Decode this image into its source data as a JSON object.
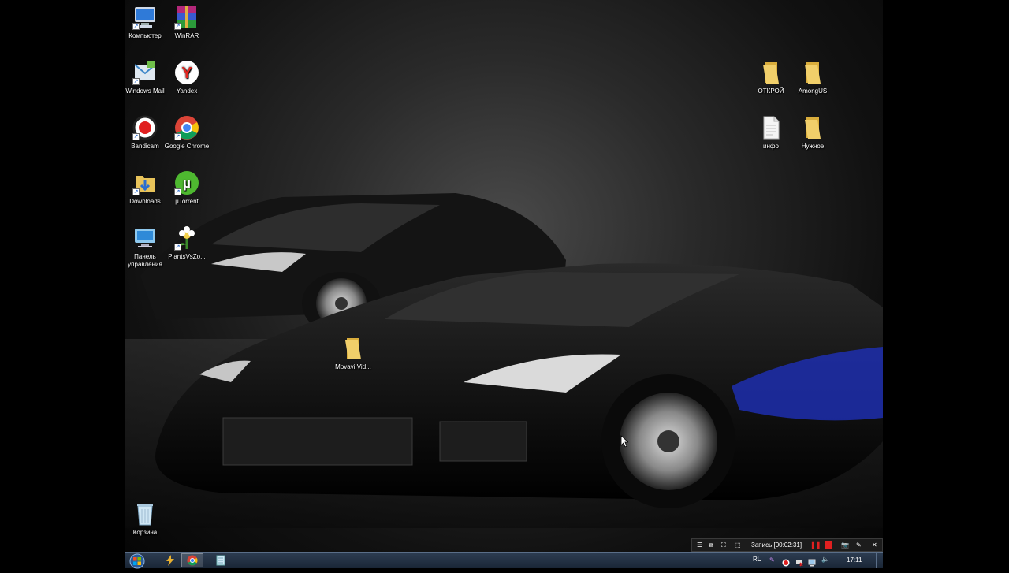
{
  "desktop": {
    "icons_left": [
      {
        "label": "Компьютер",
        "icon": "computer-icon"
      },
      {
        "label": "WinRAR",
        "icon": "winrar-icon"
      },
      {
        "label": "Windows Mail",
        "icon": "windows-mail-icon"
      },
      {
        "label": "Yandex",
        "icon": "yandex-icon"
      },
      {
        "label": "Bandicam",
        "icon": "bandicam-icon"
      },
      {
        "label": "Google Chrome",
        "icon": "chrome-icon"
      },
      {
        "label": "Downloads",
        "icon": "downloads-folder-icon"
      },
      {
        "label": "µTorrent",
        "icon": "utorrent-icon"
      },
      {
        "label": "Панель управления",
        "icon": "control-panel-icon"
      },
      {
        "label": "PlantsVsZo...",
        "icon": "plants-vs-zombies-icon"
      }
    ],
    "icons_right": [
      {
        "label": "ОТКРОЙ",
        "icon": "folder-icon"
      },
      {
        "label": "AmongUS",
        "icon": "folder-icon"
      },
      {
        "label": "инфо",
        "icon": "text-file-icon"
      },
      {
        "label": "Нужное",
        "icon": "folder-icon"
      }
    ],
    "middle_icon": {
      "label": "Movavi.Vid...",
      "icon": "folder-icon"
    },
    "recycle_bin": {
      "label": "Корзина",
      "icon": "recycle-bin-icon"
    }
  },
  "recorder": {
    "status": "Запись [00:02:31]"
  },
  "taskbar": {
    "language": "RU",
    "clock": "17:11"
  },
  "colors": {
    "folder": "#e8c35a",
    "taskbar": "#1f2d40",
    "record_red": "#e02020"
  }
}
